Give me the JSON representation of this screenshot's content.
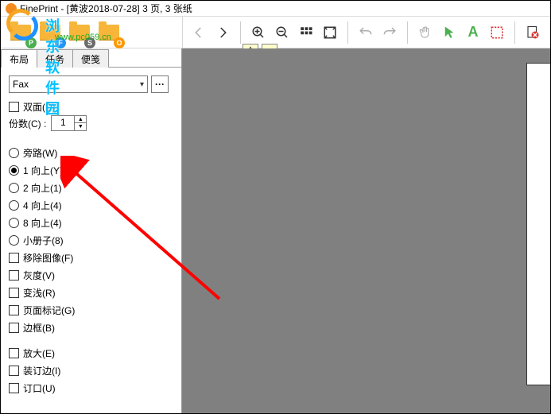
{
  "title": "FinePrint - [黄波2018-07-28] 3 页, 3 张纸",
  "watermark": {
    "text": "浏东软件园",
    "url": "www.pc059.cn"
  },
  "filebar": {
    "buttons": [
      {
        "name": "folder-p",
        "badge": "P",
        "color": "bg-green"
      },
      {
        "name": "folder-f",
        "badge": "F",
        "color": "bg-blue"
      },
      {
        "name": "folder-s",
        "badge": "S",
        "color": "bg-gray"
      },
      {
        "name": "folder-o",
        "badge": "O",
        "color": "bg-orange"
      }
    ]
  },
  "tabs": [
    "布局",
    "任务",
    "便笺"
  ],
  "printer": {
    "selected": "Fax"
  },
  "duplex": {
    "label": "双面(D)"
  },
  "copies": {
    "label": "份数(C) :",
    "value": "1"
  },
  "layout_radio": [
    {
      "label": "旁路(W)",
      "sel": false
    },
    {
      "label": "1 向上(Y)",
      "sel": true
    },
    {
      "label": "2 向上(1)",
      "sel": false
    },
    {
      "label": "4 向上(4)",
      "sel": false
    },
    {
      "label": "8 向上(4)",
      "sel": false
    },
    {
      "label": "小册子(8)",
      "sel": false
    }
  ],
  "options1": [
    {
      "label": "移除图像(F)"
    },
    {
      "label": "灰度(V)"
    },
    {
      "label": "变浅(R)"
    },
    {
      "label": "页面标记(G)"
    },
    {
      "label": "边框(B)"
    }
  ],
  "options2": [
    {
      "label": "放大(E)"
    },
    {
      "label": "装订边(I)"
    },
    {
      "label": "订口(U)"
    }
  ],
  "zoom": {
    "plus": "+",
    "minus": "−"
  }
}
